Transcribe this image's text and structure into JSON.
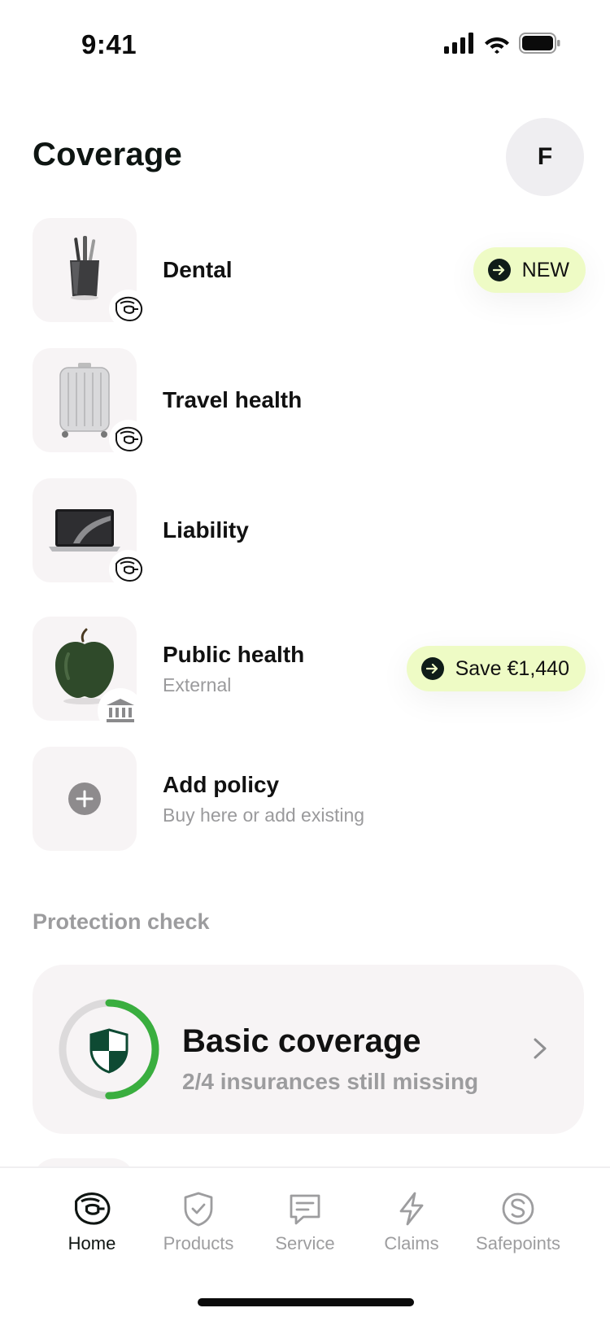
{
  "status_bar": {
    "time": "9:41"
  },
  "header": {
    "title": "Coverage",
    "avatar_initial": "F"
  },
  "coverage": [
    {
      "title": "Dental",
      "subtitle": "",
      "image": "toothbrush-cup-photo",
      "badge_icon": "brand-logo-icon",
      "pill": {
        "label": "NEW",
        "icon": "arrow-right-icon"
      }
    },
    {
      "title": "Travel health",
      "subtitle": "",
      "image": "suitcase-photo",
      "badge_icon": "brand-logo-icon"
    },
    {
      "title": "Liability",
      "subtitle": "",
      "image": "laptop-photo",
      "badge_icon": "brand-logo-icon"
    },
    {
      "title": "Public health",
      "subtitle": "External",
      "image": "apple-photo",
      "badge_icon": "bank-icon",
      "pill": {
        "label": "Save €1,440",
        "icon": "arrow-right-icon"
      }
    },
    {
      "title": "Add policy",
      "subtitle": "Buy here or add existing",
      "image": "plus-icon"
    }
  ],
  "protection_check": {
    "section_label": "Protection check",
    "title": "Basic coverage",
    "subtitle": "2/4 insurances still missing",
    "completed": 2,
    "total": 4,
    "accent_color": "#3aae3f"
  },
  "tab_bar": {
    "tabs": [
      {
        "label": "Home",
        "icon": "home-logo-icon",
        "active": true
      },
      {
        "label": "Products",
        "icon": "shield-check-icon",
        "active": false
      },
      {
        "label": "Service",
        "icon": "chat-icon",
        "active": false
      },
      {
        "label": "Claims",
        "icon": "lightning-icon",
        "active": false
      },
      {
        "label": "Safepoints",
        "icon": "safepoints-coin-icon",
        "active": false
      }
    ]
  },
  "colors": {
    "pill_background": "#eefbc5",
    "card_background": "#f7f4f5",
    "shield_dark": "#0e4a33"
  }
}
